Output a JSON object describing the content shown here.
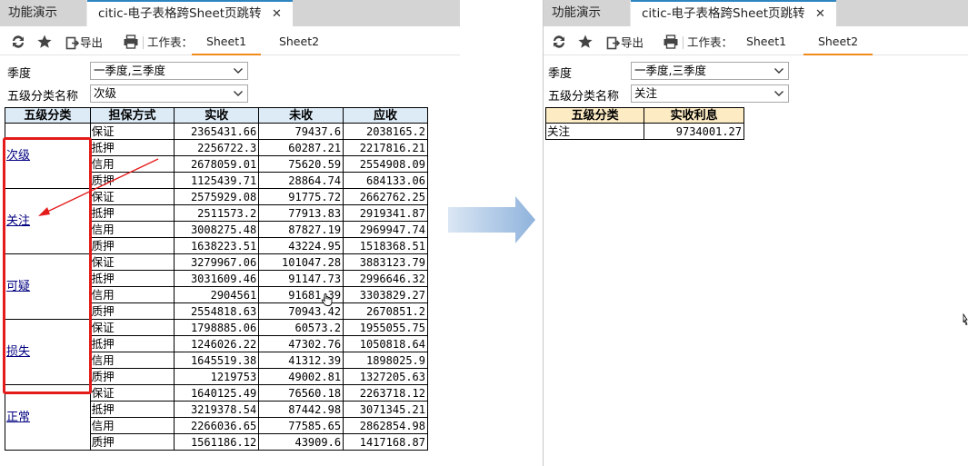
{
  "left": {
    "tabs": {
      "demo": "功能演示",
      "active": "citic-电子表格跨Sheet页跳转"
    },
    "toolbar": {
      "export": "导出",
      "worksheet_label": "工作表：",
      "sheet1": "Sheet1",
      "sheet2": "Sheet2"
    },
    "form": {
      "season_label": "季度",
      "season_value": "一季度,三季度",
      "class_label": "五级分类名称",
      "class_value": "次级"
    },
    "table": {
      "headers": [
        "五级分类",
        "担保方式",
        "实收",
        "未收",
        "应收"
      ],
      "groups": [
        {
          "category": "次级",
          "rows": [
            [
              "保证",
              "2365431.66",
              "79437.6",
              "2038165.2"
            ],
            [
              "抵押",
              "2256722.3",
              "60287.21",
              "2217816.21"
            ],
            [
              "信用",
              "2678059.01",
              "75620.59",
              "2554908.09"
            ],
            [
              "质押",
              "1125439.71",
              "28864.74",
              "684133.06"
            ]
          ]
        },
        {
          "category": "关注",
          "rows": [
            [
              "保证",
              "2575929.08",
              "91775.72",
              "2662762.25"
            ],
            [
              "抵押",
              "2511573.2",
              "77913.83",
              "2919341.87"
            ],
            [
              "信用",
              "3008275.48",
              "87827.19",
              "2969947.74"
            ],
            [
              "质押",
              "1638223.51",
              "43224.95",
              "1518368.51"
            ]
          ]
        },
        {
          "category": "可疑",
          "rows": [
            [
              "保证",
              "3279967.06",
              "101047.28",
              "3883123.79"
            ],
            [
              "抵押",
              "3031609.46",
              "91147.73",
              "2996646.32"
            ],
            [
              "信用",
              "2904561",
              "91681.39",
              "3303829.27"
            ],
            [
              "质押",
              "2554818.63",
              "70943.42",
              "2670851.2"
            ]
          ]
        },
        {
          "category": "损失",
          "rows": [
            [
              "保证",
              "1798885.06",
              "60573.2",
              "1955055.75"
            ],
            [
              "抵押",
              "1246026.22",
              "47302.76",
              "1050818.64"
            ],
            [
              "信用",
              "1645519.38",
              "41312.39",
              "1898025.9"
            ],
            [
              "质押",
              "1219753",
              "49002.81",
              "1327205.63"
            ]
          ]
        },
        {
          "category": "正常",
          "rows": [
            [
              "保证",
              "1640125.49",
              "76560.18",
              "2263718.12"
            ],
            [
              "抵押",
              "3219378.54",
              "87442.98",
              "3071345.21"
            ],
            [
              "信用",
              "2266036.65",
              "77585.65",
              "2862854.98"
            ],
            [
              "质押",
              "1561186.12",
              "43909.6",
              "1417168.87"
            ]
          ]
        }
      ]
    }
  },
  "right": {
    "tabs": {
      "demo": "功能演示",
      "active": "citic-电子表格跨Sheet页跳转"
    },
    "toolbar": {
      "export": "导出",
      "worksheet_label": "工作表：",
      "sheet1": "Sheet1",
      "sheet2": "Sheet2"
    },
    "form": {
      "season_label": "季度",
      "season_value": "一季度,三季度",
      "class_label": "五级分类名称",
      "class_value": "关注"
    },
    "table": {
      "headers": [
        "五级分类",
        "实收利息"
      ],
      "rows": [
        [
          "关注",
          "9734001.27"
        ]
      ]
    }
  },
  "colors": {
    "highlight": "#e41b1b",
    "active_sheet_tab": "#f08a1c",
    "header_left": "#ddebf7",
    "header_right": "#fdebc4",
    "link": "#000080"
  }
}
